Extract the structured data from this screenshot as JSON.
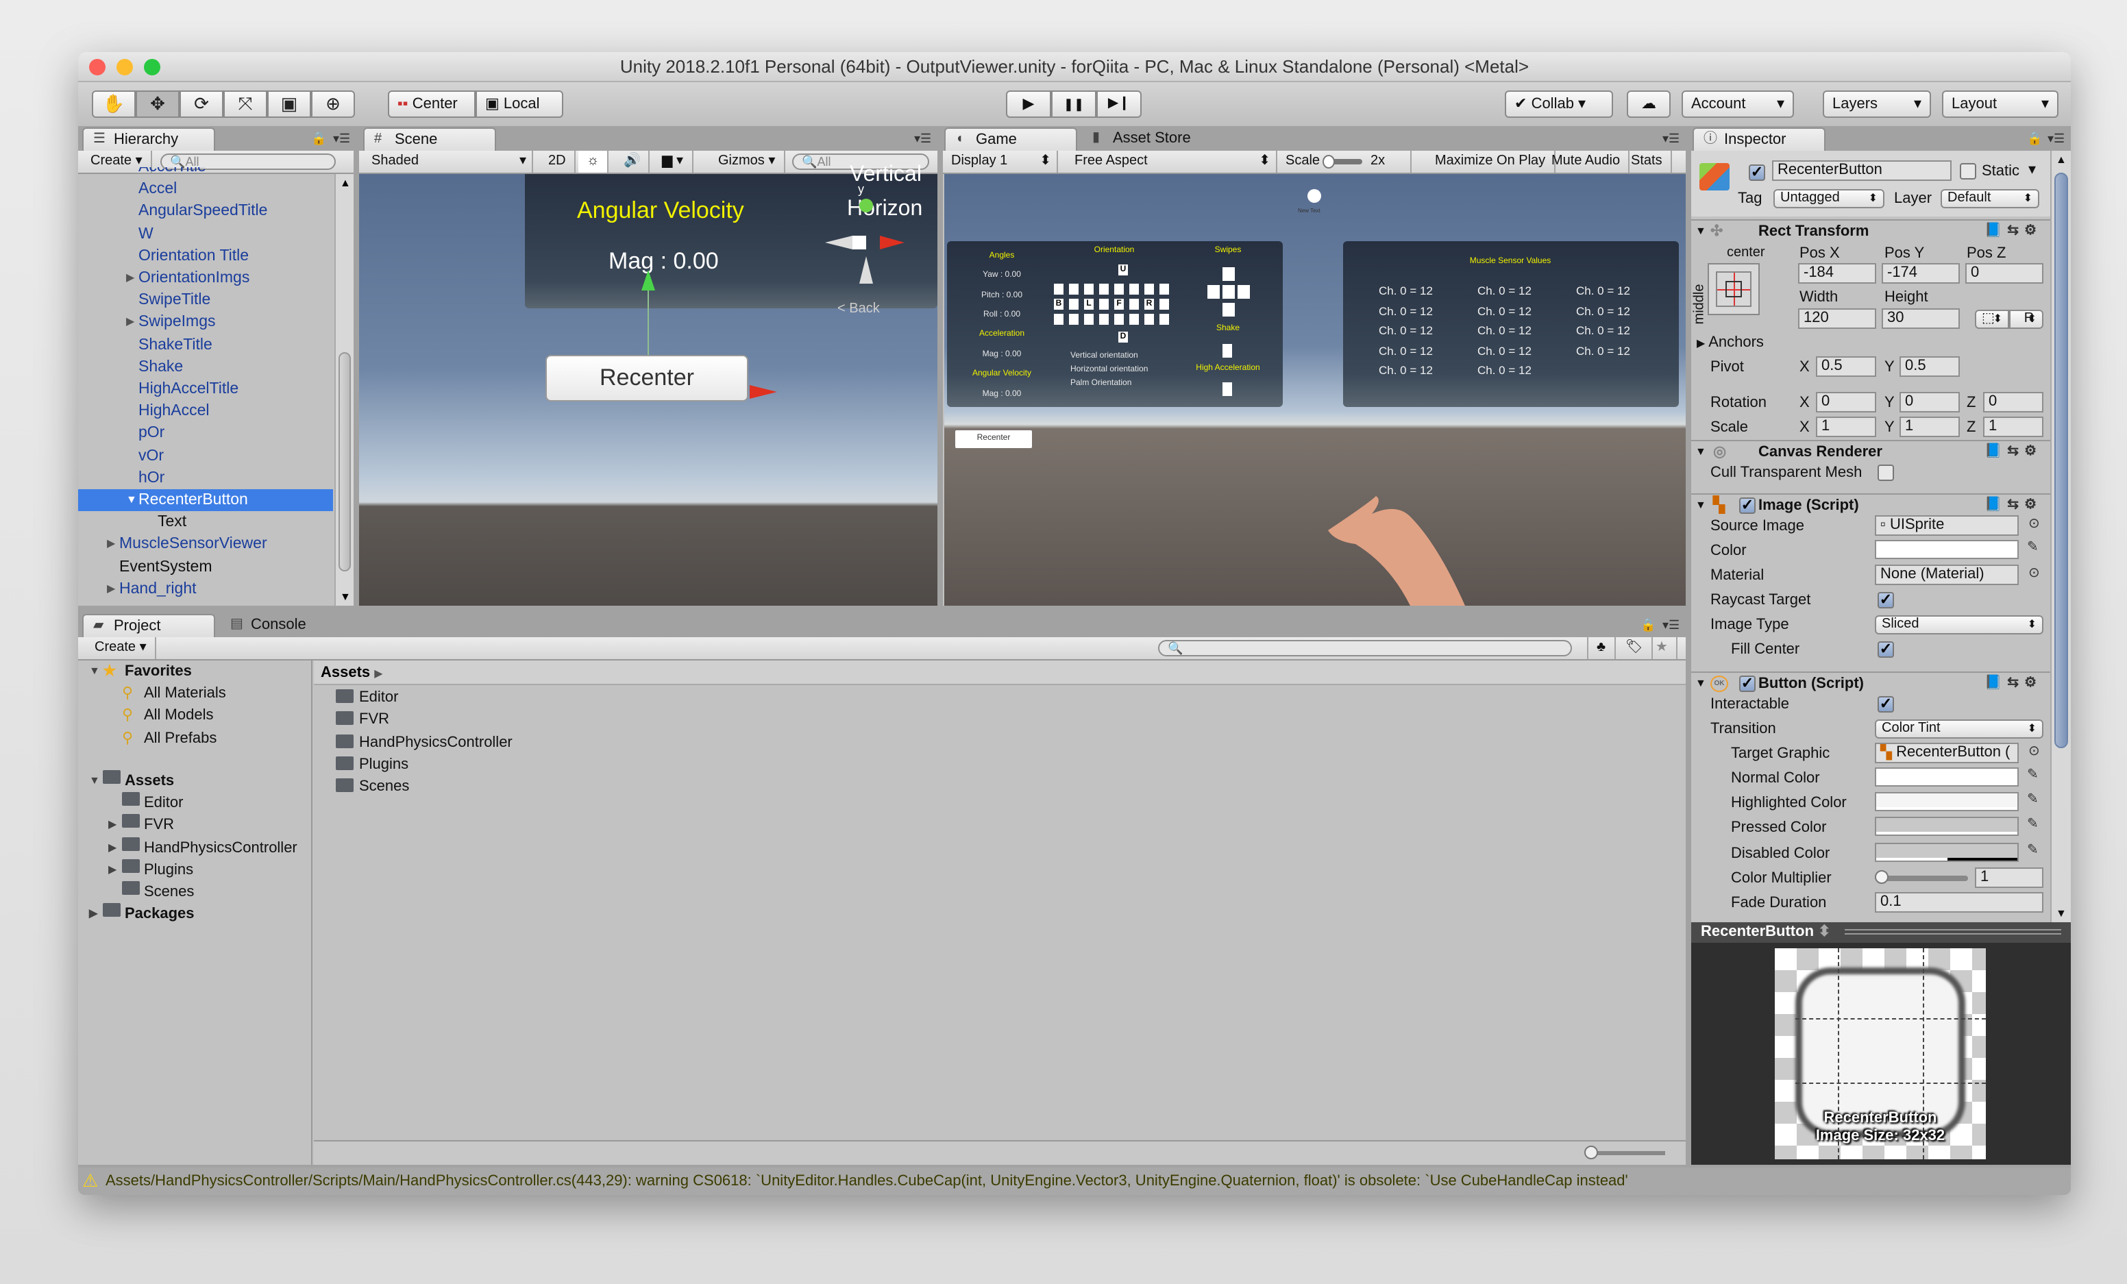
{
  "window": {
    "title": "Unity 2018.2.10f1 Personal (64bit) - OutputViewer.unity - forQiita - PC, Mac & Linux Standalone (Personal) <Metal>"
  },
  "toolbar": {
    "tools": [
      {
        "icon": "hand-icon",
        "glyph": "✋"
      },
      {
        "icon": "move-icon",
        "glyph": "✥"
      },
      {
        "icon": "rotate-icon",
        "glyph": "⟳"
      },
      {
        "icon": "scale-icon",
        "glyph": "⤧"
      },
      {
        "icon": "rect-tool-icon",
        "glyph": "▣"
      },
      {
        "icon": "transform-icon",
        "glyph": "⊕"
      }
    ],
    "pivot_mode": "Center",
    "pivot_rotation": "Local",
    "play": "▶",
    "pause": "❚❚",
    "step": "▶❙",
    "collab": "Collab",
    "account": "Account",
    "layers": "Layers",
    "layout": "Layout"
  },
  "hierarchy": {
    "tab": "Hierarchy",
    "create": "Create",
    "search_placeholder": "All",
    "items": [
      {
        "label": "AccelTitle",
        "depth": 2,
        "prefab": true
      },
      {
        "label": "Accel",
        "depth": 2,
        "prefab": true
      },
      {
        "label": "AngularSpeedTitle",
        "depth": 2,
        "prefab": true
      },
      {
        "label": "W",
        "depth": 2,
        "prefab": true
      },
      {
        "label": "Orientation Title",
        "depth": 2,
        "prefab": true
      },
      {
        "label": "OrientationImgs",
        "depth": 2,
        "prefab": true,
        "arrow": "collapsed"
      },
      {
        "label": "SwipeTitle",
        "depth": 2,
        "prefab": true
      },
      {
        "label": "SwipeImgs",
        "depth": 2,
        "prefab": true,
        "arrow": "collapsed"
      },
      {
        "label": "ShakeTitle",
        "depth": 2,
        "prefab": true
      },
      {
        "label": "Shake",
        "depth": 2,
        "prefab": true
      },
      {
        "label": "HighAccelTitle",
        "depth": 2,
        "prefab": true
      },
      {
        "label": "HighAccel",
        "depth": 2,
        "prefab": true
      },
      {
        "label": "pOr",
        "depth": 2,
        "prefab": true
      },
      {
        "label": "vOr",
        "depth": 2,
        "prefab": true
      },
      {
        "label": "hOr",
        "depth": 2,
        "prefab": true
      },
      {
        "label": "RecenterButton",
        "depth": 2,
        "prefab": true,
        "arrow": "expanded",
        "selected": true
      },
      {
        "label": "Text",
        "depth": 3,
        "prefab": false
      },
      {
        "label": "MuscleSensorViewer",
        "depth": 1,
        "prefab": true,
        "arrow": "collapsed"
      },
      {
        "label": "EventSystem",
        "depth": 1,
        "prefab": false
      },
      {
        "label": "Hand_right",
        "depth": 1,
        "prefab": true,
        "arrow": "collapsed"
      }
    ]
  },
  "scene": {
    "tab": "Scene",
    "shading": "Shaded",
    "mode_2d": "2D",
    "gizmos": "Gizmos",
    "search_placeholder": "All",
    "canvas_title": "Angular Velocity",
    "canvas_value": "Mag : 0.00",
    "gizmo_labels": {
      "vertical": "Vertical",
      "horizontal": "Horizon",
      "y": "y",
      "back": "< Back"
    },
    "button_label": "Recenter"
  },
  "game": {
    "tab": "Game",
    "asset_store_tab": "Asset Store",
    "display": "Display 1",
    "aspect": "Free Aspect",
    "scale_label": "Scale",
    "scale_value": "2x",
    "maximize": "Maximize On Play",
    "mute": "Mute Audio",
    "stats": "Stats",
    "new_text": "New Text",
    "angles": {
      "title": "Angles",
      "yaw": "Yaw : 0.00",
      "pitch": "Pitch : 0.00",
      "roll": "Roll : 0.00",
      "accel_title": "Acceleration",
      "accel_mag": "Mag : 0.00",
      "angvel_title": "Angular Velocity",
      "angvel_mag": "Mag : 0.00"
    },
    "orientation": {
      "title": "Orientation",
      "up": "U",
      "down": "D",
      "middle": [
        "B",
        "",
        "L",
        "",
        "F",
        "",
        "R",
        ""
      ],
      "vertical": "Vertical orientation",
      "horizontal": "Horizontal orientation",
      "palm": "Palm Orientation"
    },
    "swipes": {
      "title": "Swipes",
      "shake": "Shake",
      "high_accel": "High Acceleration"
    },
    "muscle": {
      "title": "Muscle Sensor Values",
      "values": [
        "Ch. 0 = 12",
        "Ch. 0 = 12",
        "Ch. 0 = 12",
        "Ch. 0 = 12",
        "Ch. 0 = 12",
        "Ch. 0 = 12",
        "Ch. 0 = 12",
        "Ch. 0 = 12",
        "Ch. 0 = 12",
        "Ch. 0 = 12",
        "Ch. 0 = 12",
        "Ch. 0 = 12",
        "Ch. 0 = 12",
        "Ch. 0 = 12"
      ]
    },
    "recenter_label": "Recenter"
  },
  "inspector": {
    "tab": "Inspector",
    "object_name": "RecenterButton",
    "active": true,
    "static_label": "Static",
    "static": false,
    "tag_label": "Tag",
    "tag": "Untagged",
    "layer_label": "Layer",
    "layer": "Default",
    "rect": {
      "title": "Rect Transform",
      "anchor_h": "center",
      "anchor_v": "middle",
      "posx_label": "Pos X",
      "posy_label": "Pos Y",
      "posz_label": "Pos Z",
      "posx": "-184",
      "posy": "-174",
      "posz": "0",
      "width_label": "Width",
      "height_label": "Height",
      "width": "120",
      "height": "30",
      "raw_button": "R",
      "anchors": "Anchors",
      "pivot": "Pivot",
      "pivot_x": "0.5",
      "pivot_y": "0.5",
      "rotation": "Rotation",
      "rot_x": "0",
      "rot_y": "0",
      "rot_z": "0",
      "scale": "Scale",
      "scale_x": "1",
      "scale_y": "1",
      "scale_z": "1",
      "x": "X",
      "y": "Y",
      "z": "Z"
    },
    "canvas_renderer": {
      "title": "Canvas Renderer",
      "cull_label": "Cull Transparent Mesh",
      "cull": false
    },
    "image": {
      "title": "Image (Script)",
      "source_label": "Source Image",
      "source": "UISprite",
      "color_label": "Color",
      "color": "#ffffff",
      "material_label": "Material",
      "material": "None (Material)",
      "raycast_label": "Raycast Target",
      "raycast": true,
      "type_label": "Image Type",
      "type": "Sliced",
      "fill_label": "Fill Center",
      "fill": true
    },
    "button": {
      "title": "Button (Script)",
      "interactable_label": "Interactable",
      "interactable": true,
      "transition_label": "Transition",
      "transition": "Color Tint",
      "target_label": "Target Graphic",
      "target": "RecenterButton (",
      "normal_label": "Normal Color",
      "normal": "#ffffff",
      "highlighted_label": "Highlighted Color",
      "highlighted": "#f5f5f5",
      "pressed_label": "Pressed Color",
      "pressed": "#c8c8c8",
      "disabled_label": "Disabled Color",
      "disabled": "#c8c8c8",
      "multiplier_label": "Color Multiplier",
      "multiplier": "1",
      "fade_label": "Fade Duration",
      "fade": "0.1"
    },
    "preview": {
      "title": "RecenterButton",
      "caption": "RecenterButton",
      "size": "Image Size: 32x32"
    }
  },
  "project": {
    "tab": "Project",
    "console_tab": "Console",
    "create": "Create",
    "favorites": {
      "label": "Favorites",
      "items": [
        "All Materials",
        "All Models",
        "All Prefabs"
      ]
    },
    "assets": {
      "label": "Assets",
      "items": [
        {
          "label": "Editor"
        },
        {
          "label": "FVR",
          "arrow": true
        },
        {
          "label": "HandPhysicsController",
          "arrow": true
        },
        {
          "label": "Plugins",
          "arrow": true
        },
        {
          "label": "Scenes"
        }
      ]
    },
    "packages": "Packages",
    "breadcrumb": "Assets",
    "contents": [
      "Editor",
      "FVR",
      "HandPhysicsController",
      "Plugins",
      "Scenes"
    ]
  },
  "status": {
    "message": "Assets/HandPhysicsController/Scripts/Main/HandPhysicsController.cs(443,29): warning CS0618: `UnityEditor.Handles.CubeCap(int, UnityEngine.Vector3, UnityEngine.Quaternion, float)' is obsolete: `Use CubeHandleCap instead'"
  },
  "colors": {
    "selection": "#3d7ee6",
    "prefab_text": "#1a3d9c",
    "canvas_text_accent": "#f2f200",
    "warning": "#f5d020"
  }
}
